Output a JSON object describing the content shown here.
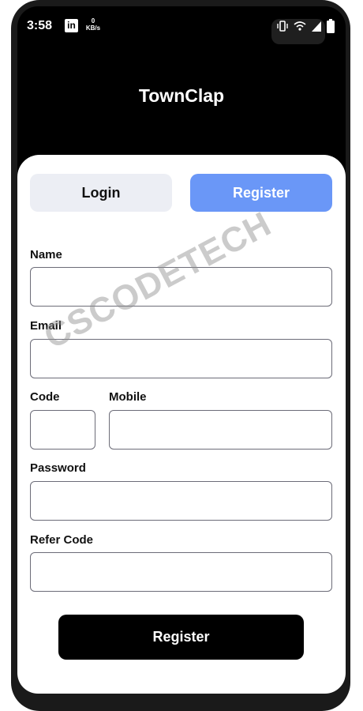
{
  "status_bar": {
    "time": "3:58",
    "network_speed_value": "0",
    "network_speed_unit": "KB/s",
    "icons": [
      "linkedin-icon",
      "vibrate-icon",
      "wifi-icon",
      "signal-icon",
      "battery-icon"
    ]
  },
  "app": {
    "title": "TownClap"
  },
  "tabs": {
    "login": "Login",
    "register": "Register",
    "active": "register"
  },
  "form": {
    "name_label": "Name",
    "email_label": "Email",
    "code_label": "Code",
    "mobile_label": "Mobile",
    "password_label": "Password",
    "refer_code_label": "Refer Code",
    "name_value": "",
    "email_value": "",
    "code_value": "",
    "mobile_value": "",
    "password_value": "",
    "refer_code_value": "",
    "submit_label": "Register"
  },
  "watermark": "CSCODETECH",
  "colors": {
    "accent": "#6a97f7",
    "inactive_tab": "#eceef4",
    "header": "#000000",
    "submit_button": "#000000"
  }
}
